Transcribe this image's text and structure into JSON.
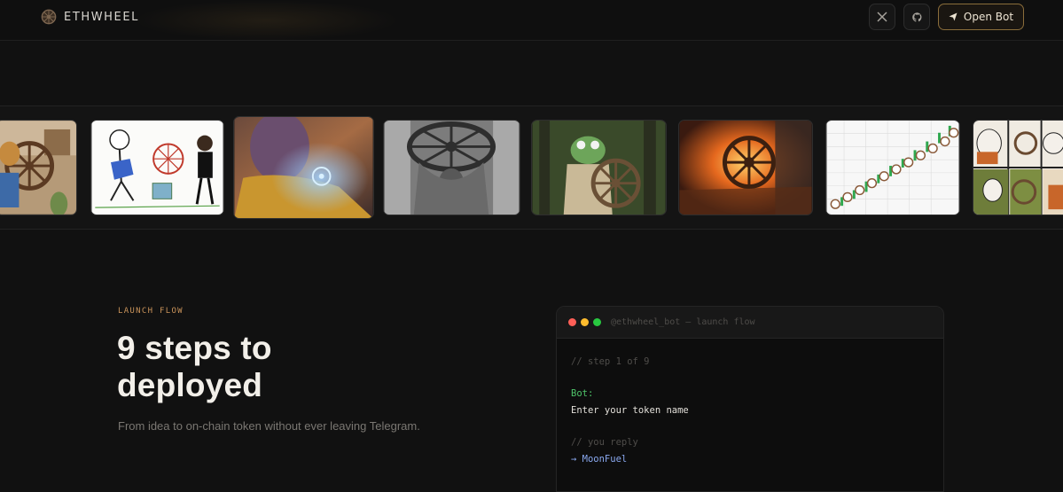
{
  "nav": {
    "brand": "ETHWHEEL",
    "x_icon": "x-icon",
    "github_icon": "github-icon",
    "open_bot_label": "Open Bot",
    "open_bot_icon": "send-icon"
  },
  "gallery": {
    "items": [
      {
        "name": "bear-with-wheel"
      },
      {
        "name": "stick-figures-wheel"
      },
      {
        "name": "thanos-wheel"
      },
      {
        "name": "strongman-wheel"
      },
      {
        "name": "pepe-wheel"
      },
      {
        "name": "burning-wheel"
      },
      {
        "name": "wheel-chart"
      },
      {
        "name": "comic-wheel"
      }
    ]
  },
  "launch": {
    "eyebrow": "LAUNCH FLOW",
    "headline_line1": "9 steps to",
    "headline_line2": "deployed",
    "subtext": "From idea to on-chain token without ever leaving Telegram."
  },
  "terminal": {
    "title": "@ethwheel_bot — launch flow",
    "step_comment": "// step 1 of 9",
    "bot_label": "Bot:",
    "bot_message": "Enter your token name",
    "reply_comment": "// you reply",
    "reply_value": "→ MoonFuel"
  },
  "colors": {
    "accent": "#c9935a",
    "bot_green": "#4fc46a",
    "reply_blue": "#8aa9f0",
    "dot_red": "#ff5f57",
    "dot_yellow": "#febc2e",
    "dot_green": "#28c840"
  }
}
